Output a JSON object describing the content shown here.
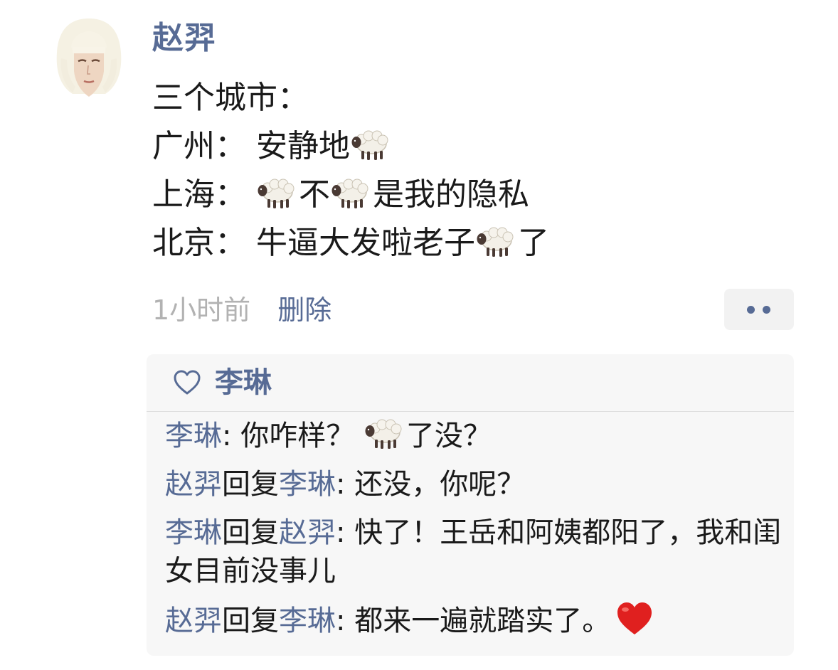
{
  "post": {
    "author": "赵羿",
    "lines": [
      {
        "t1": "三个城市："
      },
      {
        "t1": "广州：  安静地"
      },
      {
        "t1": "上海：  ",
        "t2": "不",
        "t3": "是我的隐私"
      },
      {
        "t1": "北京：  牛逼大发啦老子",
        "t2": "了"
      }
    ],
    "timestamp": "1小时前",
    "delete_label": "删除"
  },
  "likes": {
    "names": [
      "李琳"
    ]
  },
  "comments": [
    {
      "from": "李琳",
      "t1": ": 你咋样？  ",
      "t2": "了没？"
    },
    {
      "from": "赵羿",
      "reply_word": "回复",
      "to": "李琳",
      "text": ": 还没，你呢？"
    },
    {
      "from": "李琳",
      "reply_word": "回复",
      "to": "赵羿",
      "text": ": 快了！王岳和阿姨都阳了，我和闺女目前没事儿"
    },
    {
      "from": "赵羿",
      "reply_word": "回复",
      "to": "李琳",
      "text": ": 都来一遍就踏实了。"
    }
  ],
  "icons": {
    "sheep": "sheep-emoji-icon",
    "heart": "red-heart-emoji-icon",
    "like": "heart-outline-icon",
    "more": "more-dots-icon"
  },
  "colors": {
    "link": "#576b95",
    "meta": "#b2b2b2",
    "comment_bg": "#f7f7f7",
    "heart": "#e0201f"
  }
}
